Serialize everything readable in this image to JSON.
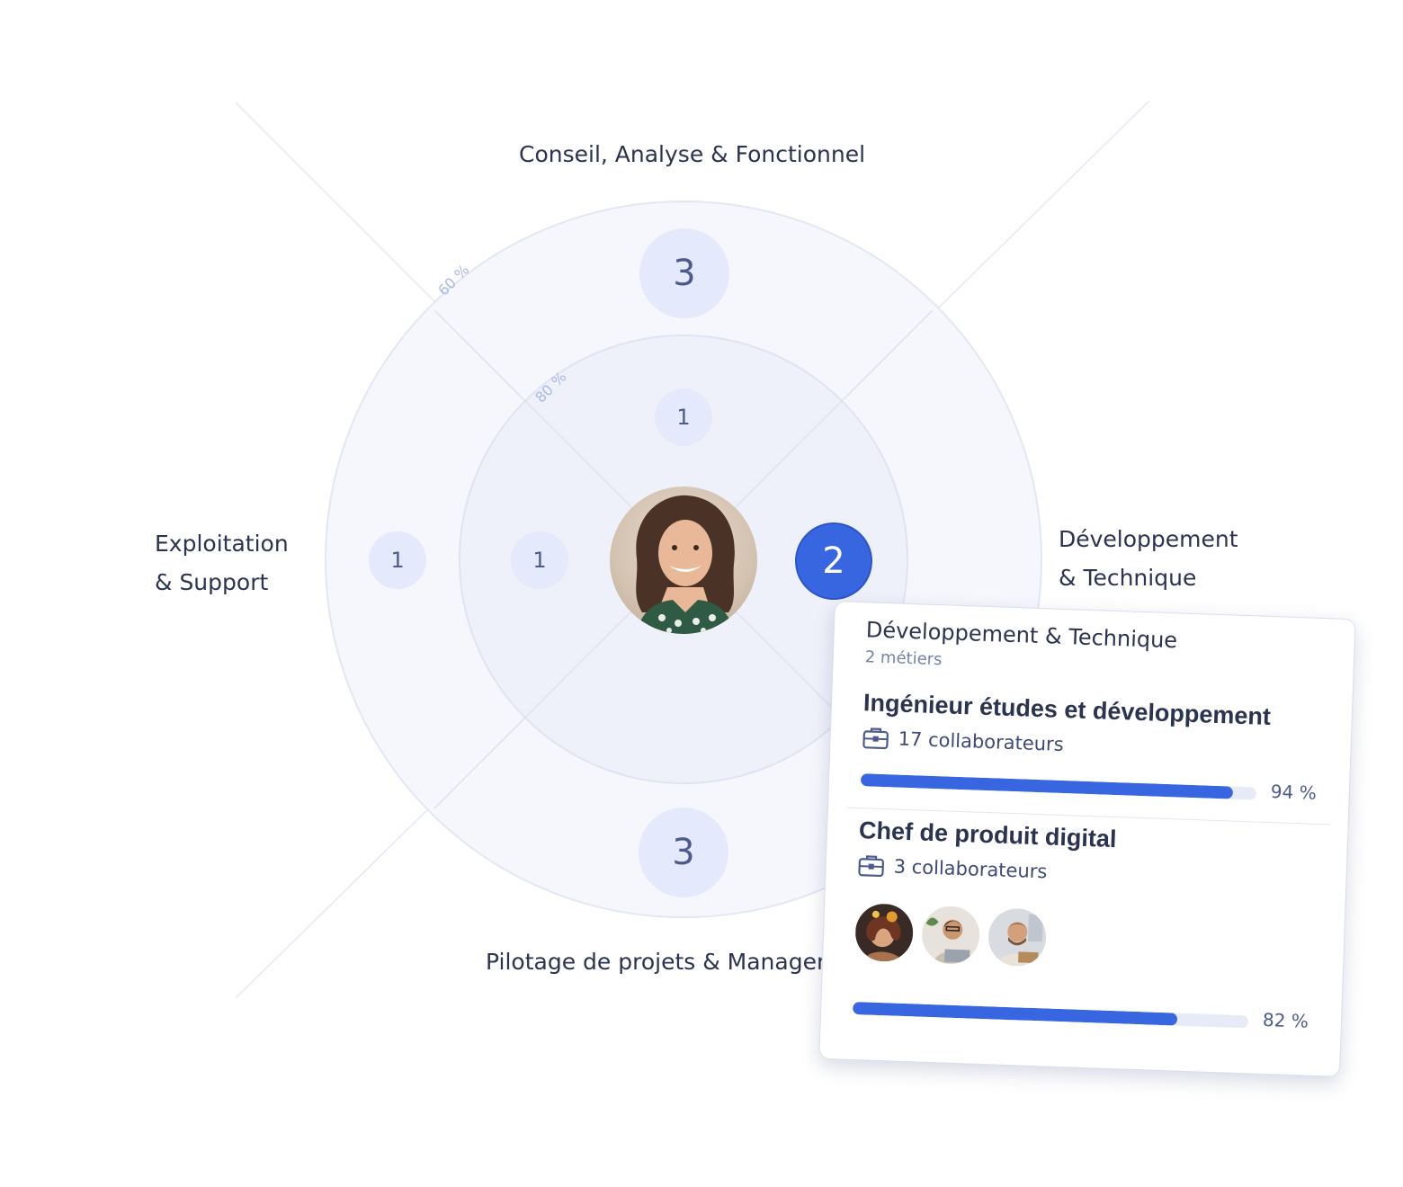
{
  "categories": {
    "top": "Conseil, Analyse & Fonctionnel",
    "left_line1": "Exploitation",
    "left_line2": "& Support",
    "right_line1": "Développement",
    "right_line2": "& Technique",
    "bottom": "Pilotage de projets & Manager"
  },
  "rings": {
    "outer_label": "60 %",
    "inner_label": "80 %"
  },
  "counts": {
    "top_outer": "3",
    "top_inner": "1",
    "left_outer": "1",
    "left_inner": "1",
    "right_inner_active": "2",
    "bottom_outer": "3"
  },
  "card": {
    "title": "Développement & Technique",
    "subtitle": "2 métiers",
    "jobs": [
      {
        "title": "Ingénieur études et développement",
        "collaborators": "17 collaborateurs",
        "progress": 0.94,
        "progress_label": "94 %"
      },
      {
        "title": "Chef de produit digital",
        "collaborators": "3 collaborateurs",
        "progress": 0.82,
        "progress_label": "82 %"
      }
    ]
  },
  "colors": {
    "accent": "#3766e0",
    "track": "#e7ebf7",
    "bubble": "#e4e9fb",
    "text": "#2a3350"
  },
  "icons": {
    "collaborators": "briefcase-icon"
  }
}
